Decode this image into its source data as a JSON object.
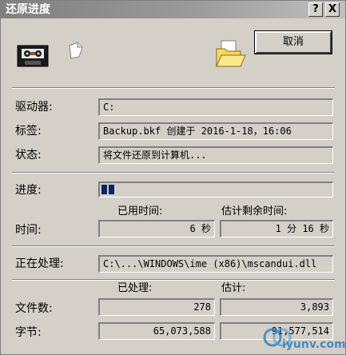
{
  "window": {
    "title": "还原进度",
    "help_button": "?",
    "close_button": "X"
  },
  "actions": {
    "cancel_label": "取消"
  },
  "info": {
    "drive_label": "驱动器:",
    "drive_value": "C:",
    "tag_label": "标签:",
    "tag_value": "Backup.bkf 创建于 2016-1-18，16:06",
    "status_label": "状态:",
    "status_value": "将文件还原到计算机..."
  },
  "progress": {
    "label": "进度:",
    "fraction": 0.07
  },
  "time": {
    "label": "时间:",
    "elapsed_header": "已用时间:",
    "remaining_header": "估计剩余时间:",
    "elapsed_value": "6 秒",
    "remaining_value": "1 分 16 秒"
  },
  "processing": {
    "label": "正在处理:",
    "path": "C:\\...\\WINDOWS\\ime (x86)\\mscandui.dll"
  },
  "stats": {
    "processed_header": "已处理:",
    "estimated_header": "估计:",
    "files_label": "文件数:",
    "files_processed": "278",
    "files_estimated": "3,893",
    "bytes_label": "字节:",
    "bytes_processed": "65,073,588",
    "bytes_estimated": "91,577,514"
  },
  "watermark": {
    "text": "iyunv.com"
  },
  "icons": {
    "tape": "tape-cassette-icon",
    "paper": "flying-paper-icon",
    "folder": "open-folder-icon"
  }
}
